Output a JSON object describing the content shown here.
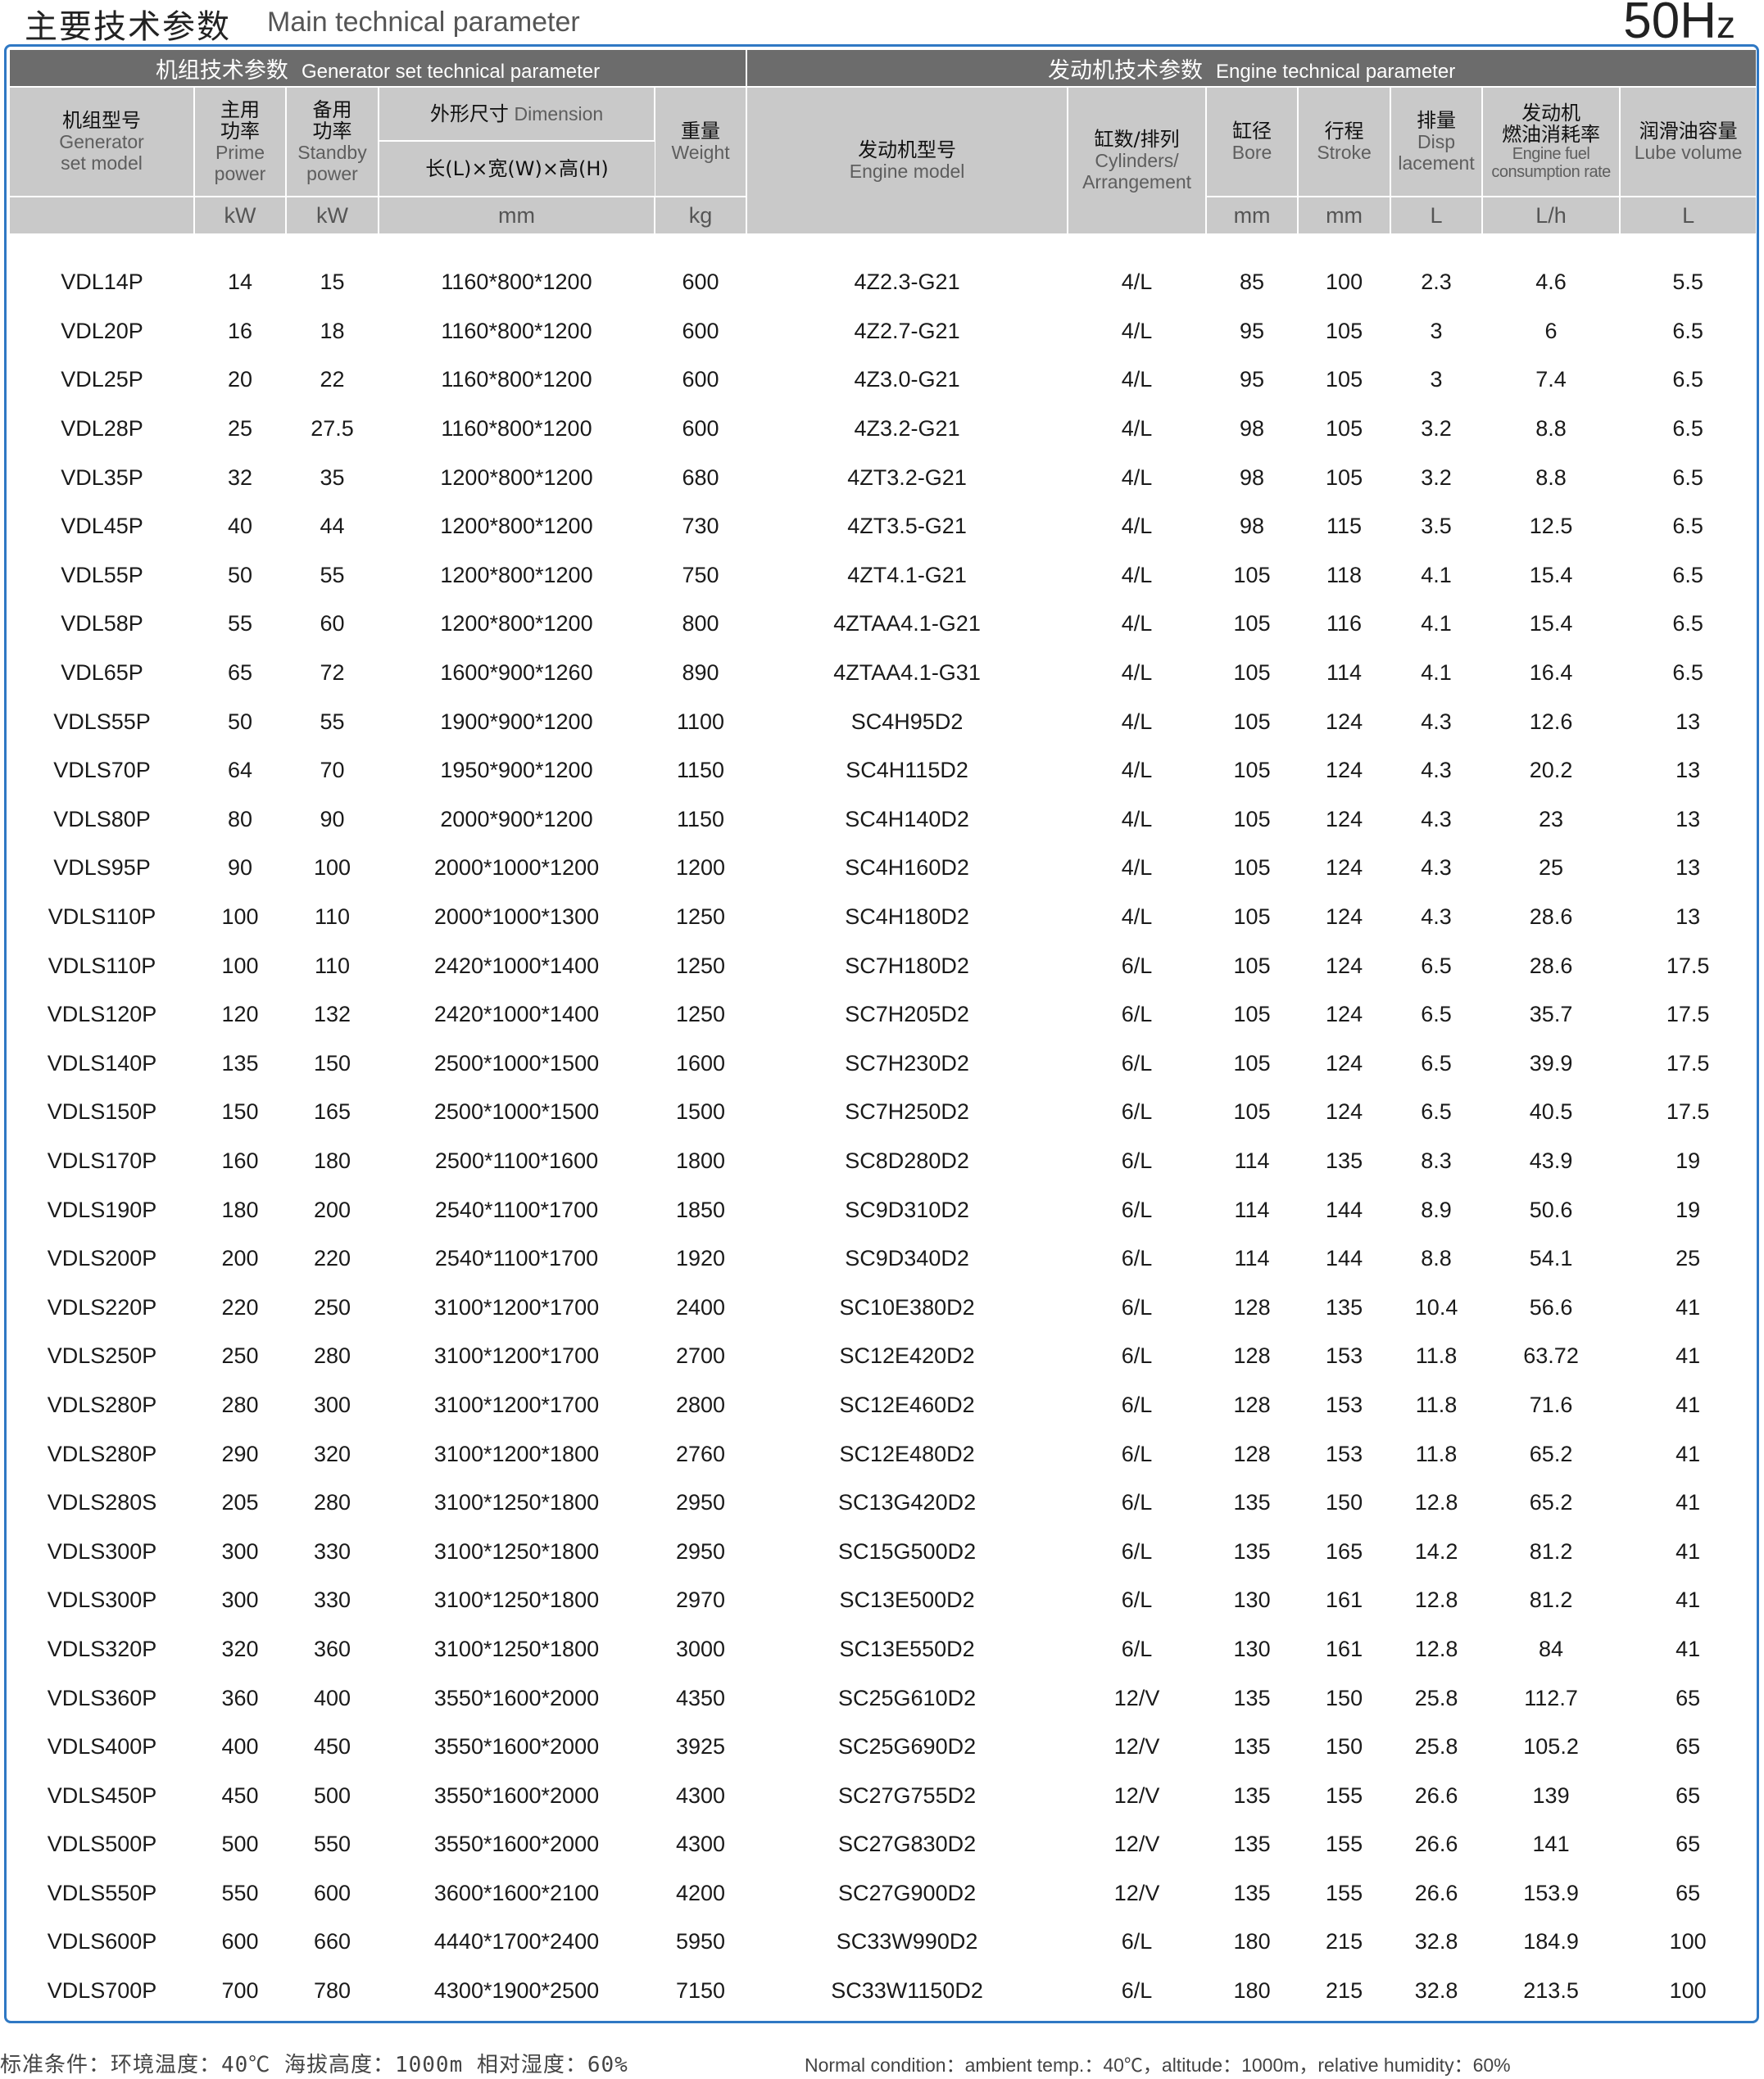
{
  "header": {
    "title_cn": "主要技术参数",
    "title_en": "Main technical parameter",
    "frequency_value": "50H",
    "frequency_suffix": "z"
  },
  "groups": {
    "generator": {
      "cn": "机组技术参数",
      "en": "Generator set technical parameter"
    },
    "engine": {
      "cn": "发动机技术参数",
      "en": "Engine technical parameter"
    }
  },
  "columns": {
    "model": {
      "cn": "机组型号",
      "en1": "Generator",
      "en2": "set model"
    },
    "prime": {
      "cn1": "主用",
      "cn2": "功率",
      "en1": "Prime",
      "en2": "power",
      "unit": "kW"
    },
    "standby": {
      "cn1": "备用",
      "cn2": "功率",
      "en1": "Standby",
      "en2": "power",
      "unit": "kW"
    },
    "dimension": {
      "cn": "外形尺寸",
      "en": "Dimension",
      "sub": "长(L)×宽(W)×高(H)",
      "unit": "mm"
    },
    "weight": {
      "cn": "重量",
      "en": "Weight",
      "unit": "kg"
    },
    "engine_model": {
      "cn": "发动机型号",
      "en": "Engine model"
    },
    "cylinders": {
      "cn": "缸数/排列",
      "en1": "Cylinders/",
      "en2": "Arrangement"
    },
    "bore": {
      "cn": "缸径",
      "en": "Bore",
      "unit": "mm"
    },
    "stroke": {
      "cn": "行程",
      "en": "Stroke",
      "unit": "mm"
    },
    "displacement": {
      "cn": "排量",
      "en1": "Disp",
      "en2": "lacement",
      "unit": "L"
    },
    "fuel": {
      "cn1": "发动机",
      "cn2": "燃油消耗率",
      "en1": "Engine fuel",
      "en2": "consumption rate",
      "unit": "L/h"
    },
    "lube": {
      "cn": "润滑油容量",
      "en": "Lube volume",
      "unit": "L"
    }
  },
  "rows": [
    [
      "VDL14P",
      "14",
      "15",
      "1160*800*1200",
      "600",
      "4Z2.3-G21",
      "4/L",
      "85",
      "100",
      "2.3",
      "4.6",
      "5.5"
    ],
    [
      "VDL20P",
      "16",
      "18",
      "1160*800*1200",
      "600",
      "4Z2.7-G21",
      "4/L",
      "95",
      "105",
      "3",
      "6",
      "6.5"
    ],
    [
      "VDL25P",
      "20",
      "22",
      "1160*800*1200",
      "600",
      "4Z3.0-G21",
      "4/L",
      "95",
      "105",
      "3",
      "7.4",
      "6.5"
    ],
    [
      "VDL28P",
      "25",
      "27.5",
      "1160*800*1200",
      "600",
      "4Z3.2-G21",
      "4/L",
      "98",
      "105",
      "3.2",
      "8.8",
      "6.5"
    ],
    [
      "VDL35P",
      "32",
      "35",
      "1200*800*1200",
      "680",
      "4ZT3.2-G21",
      "4/L",
      "98",
      "105",
      "3.2",
      "8.8",
      "6.5"
    ],
    [
      "VDL45P",
      "40",
      "44",
      "1200*800*1200",
      "730",
      "4ZT3.5-G21",
      "4/L",
      "98",
      "115",
      "3.5",
      "12.5",
      "6.5"
    ],
    [
      "VDL55P",
      "50",
      "55",
      "1200*800*1200",
      "750",
      "4ZT4.1-G21",
      "4/L",
      "105",
      "118",
      "4.1",
      "15.4",
      "6.5"
    ],
    [
      "VDL58P",
      "55",
      "60",
      "1200*800*1200",
      "800",
      "4ZTAA4.1-G21",
      "4/L",
      "105",
      "116",
      "4.1",
      "15.4",
      "6.5"
    ],
    [
      "VDL65P",
      "65",
      "72",
      "1600*900*1260",
      "890",
      "4ZTAA4.1-G31",
      "4/L",
      "105",
      "114",
      "4.1",
      "16.4",
      "6.5"
    ],
    [
      "VDLS55P",
      "50",
      "55",
      "1900*900*1200",
      "1100",
      "SC4H95D2",
      "4/L",
      "105",
      "124",
      "4.3",
      "12.6",
      "13"
    ],
    [
      "VDLS70P",
      "64",
      "70",
      "1950*900*1200",
      "1150",
      "SC4H115D2",
      "4/L",
      "105",
      "124",
      "4.3",
      "20.2",
      "13"
    ],
    [
      "VDLS80P",
      "80",
      "90",
      "2000*900*1200",
      "1150",
      "SC4H140D2",
      "4/L",
      "105",
      "124",
      "4.3",
      "23",
      "13"
    ],
    [
      "VDLS95P",
      "90",
      "100",
      "2000*1000*1200",
      "1200",
      "SC4H160D2",
      "4/L",
      "105",
      "124",
      "4.3",
      "25",
      "13"
    ],
    [
      "VDLS110P",
      "100",
      "110",
      "2000*1000*1300",
      "1250",
      "SC4H180D2",
      "4/L",
      "105",
      "124",
      "4.3",
      "28.6",
      "13"
    ],
    [
      "VDLS110P",
      "100",
      "110",
      "2420*1000*1400",
      "1250",
      "SC7H180D2",
      "6/L",
      "105",
      "124",
      "6.5",
      "28.6",
      "17.5"
    ],
    [
      "VDLS120P",
      "120",
      "132",
      "2420*1000*1400",
      "1250",
      "SC7H205D2",
      "6/L",
      "105",
      "124",
      "6.5",
      "35.7",
      "17.5"
    ],
    [
      "VDLS140P",
      "135",
      "150",
      "2500*1000*1500",
      "1600",
      "SC7H230D2",
      "6/L",
      "105",
      "124",
      "6.5",
      "39.9",
      "17.5"
    ],
    [
      "VDLS150P",
      "150",
      "165",
      "2500*1000*1500",
      "1500",
      "SC7H250D2",
      "6/L",
      "105",
      "124",
      "6.5",
      "40.5",
      "17.5"
    ],
    [
      "VDLS170P",
      "160",
      "180",
      "2500*1100*1600",
      "1800",
      "SC8D280D2",
      "6/L",
      "114",
      "135",
      "8.3",
      "43.9",
      "19"
    ],
    [
      "VDLS190P",
      "180",
      "200",
      "2540*1100*1700",
      "1850",
      "SC9D310D2",
      "6/L",
      "114",
      "144",
      "8.9",
      "50.6",
      "19"
    ],
    [
      "VDLS200P",
      "200",
      "220",
      "2540*1100*1700",
      "1920",
      "SC9D340D2",
      "6/L",
      "114",
      "144",
      "8.8",
      "54.1",
      "25"
    ],
    [
      "VDLS220P",
      "220",
      "250",
      "3100*1200*1700",
      "2400",
      "SC10E380D2",
      "6/L",
      "128",
      "135",
      "10.4",
      "56.6",
      "41"
    ],
    [
      "VDLS250P",
      "250",
      "280",
      "3100*1200*1700",
      "2700",
      "SC12E420D2",
      "6/L",
      "128",
      "153",
      "11.8",
      "63.72",
      "41"
    ],
    [
      "VDLS280P",
      "280",
      "300",
      "3100*1200*1700",
      "2800",
      "SC12E460D2",
      "6/L",
      "128",
      "153",
      "11.8",
      "71.6",
      "41"
    ],
    [
      "VDLS280P",
      "290",
      "320",
      "3100*1200*1800",
      "2760",
      "SC12E480D2",
      "6/L",
      "128",
      "153",
      "11.8",
      "65.2",
      "41"
    ],
    [
      "VDLS280S",
      "205",
      "280",
      "3100*1250*1800",
      "2950",
      "SC13G420D2",
      "6/L",
      "135",
      "150",
      "12.8",
      "65.2",
      "41"
    ],
    [
      "VDLS300P",
      "300",
      "330",
      "3100*1250*1800",
      "2950",
      "SC15G500D2",
      "6/L",
      "135",
      "165",
      "14.2",
      "81.2",
      "41"
    ],
    [
      "VDLS300P",
      "300",
      "330",
      "3100*1250*1800",
      "2970",
      "SC13E500D2",
      "6/L",
      "130",
      "161",
      "12.8",
      "81.2",
      "41"
    ],
    [
      "VDLS320P",
      "320",
      "360",
      "3100*1250*1800",
      "3000",
      "SC13E550D2",
      "6/L",
      "130",
      "161",
      "12.8",
      "84",
      "41"
    ],
    [
      "VDLS360P",
      "360",
      "400",
      "3550*1600*2000",
      "4350",
      "SC25G610D2",
      "12/V",
      "135",
      "150",
      "25.8",
      "112.7",
      "65"
    ],
    [
      "VDLS400P",
      "400",
      "450",
      "3550*1600*2000",
      "3925",
      "SC25G690D2",
      "12/V",
      "135",
      "150",
      "25.8",
      "105.2",
      "65"
    ],
    [
      "VDLS450P",
      "450",
      "500",
      "3550*1600*2000",
      "4300",
      "SC27G755D2",
      "12/V",
      "135",
      "155",
      "26.6",
      "139",
      "65"
    ],
    [
      "VDLS500P",
      "500",
      "550",
      "3550*1600*2000",
      "4300",
      "SC27G830D2",
      "12/V",
      "135",
      "155",
      "26.6",
      "141",
      "65"
    ],
    [
      "VDLS550P",
      "550",
      "600",
      "3600*1600*2100",
      "4200",
      "SC27G900D2",
      "12/V",
      "135",
      "155",
      "26.6",
      "153.9",
      "65"
    ],
    [
      "VDLS600P",
      "600",
      "660",
      "4440*1700*2400",
      "5950",
      "SC33W990D2",
      "6/L",
      "180",
      "215",
      "32.8",
      "184.9",
      "100"
    ],
    [
      "VDLS700P",
      "700",
      "780",
      "4300*1900*2500",
      "7150",
      "SC33W1150D2",
      "6/L",
      "180",
      "215",
      "32.8",
      "213.5",
      "100"
    ]
  ],
  "footer": {
    "cn": "标准条件：环境温度：40℃   海拔高度：1000m   相对湿度：60%",
    "en": "Normal condition：ambient temp.：40℃，altitude：1000m，relative humidity：60%"
  }
}
